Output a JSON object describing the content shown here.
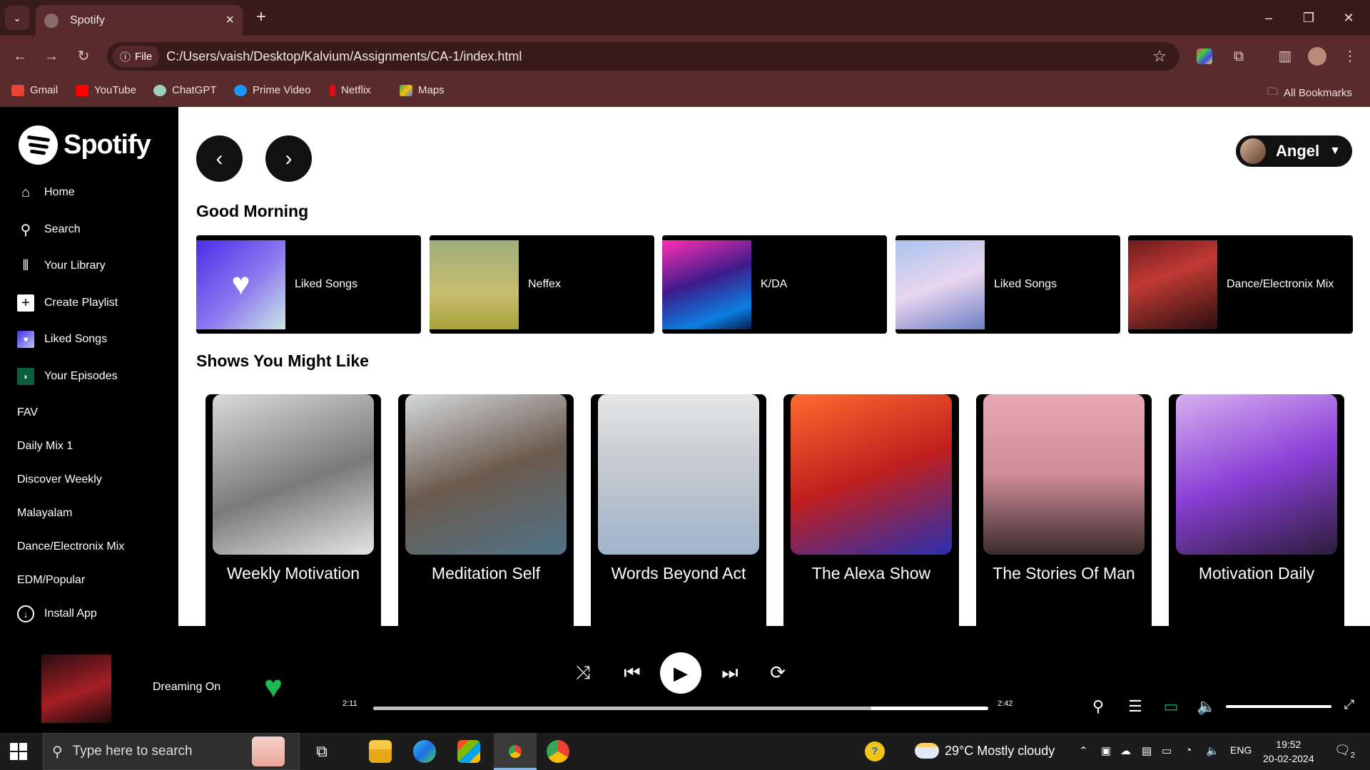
{
  "browser": {
    "tab_title": "Spotify",
    "site_chip": "File",
    "url": "C:/Users/vaish/Desktop/Kalvium/Assignments/CA-1/index.html",
    "bookmarks": [
      "Gmail",
      "YouTube",
      "ChatGPT",
      "Prime Video",
      "Netflix",
      "Maps"
    ],
    "all_bookmarks": "All Bookmarks"
  },
  "sidebar": {
    "logo_text": "Spotify",
    "nav": [
      {
        "label": "Home",
        "icon": "home-icon"
      },
      {
        "label": "Search",
        "icon": "search-icon"
      },
      {
        "label": "Your Library",
        "icon": "library-icon"
      },
      {
        "label": "Create Playlist",
        "icon": "plus-icon"
      },
      {
        "label": "Liked Songs",
        "icon": "liked-songs-icon"
      },
      {
        "label": "Your Episodes",
        "icon": "episodes-icon"
      }
    ],
    "playlists": [
      "FAV",
      "Daily Mix 1",
      "Discover Weekly",
      "Malayalam",
      "Dance/Electronix Mix",
      "EDM/Popular"
    ],
    "install": "Install App"
  },
  "header": {
    "user_name": "Angel"
  },
  "good_morning": {
    "title": "Good Morning",
    "cards": [
      "Liked Songs",
      "Neffex",
      "K/DA",
      "Liked Songs",
      "Dance/Electronix Mix"
    ]
  },
  "shows": {
    "title": "Shows You Might Like",
    "items": [
      "Weekly Motivation",
      "Meditation Self",
      "Words Beyond Act",
      "The Alexa Show",
      "The Stories Of Man",
      "Motivation Daily"
    ]
  },
  "player": {
    "track_title": "Dreaming On",
    "liked": true,
    "current_time": "2:11",
    "total_time": "2:42",
    "progress_fraction": 0.81,
    "volume_fraction": 1.0,
    "accent_color": "#1db954"
  },
  "taskbar": {
    "search_placeholder": "Type here to search",
    "weather": "29°C  Mostly cloudy",
    "language": "ENG",
    "time": "19:52",
    "date": "20-02-2024",
    "notification_count": "2"
  }
}
